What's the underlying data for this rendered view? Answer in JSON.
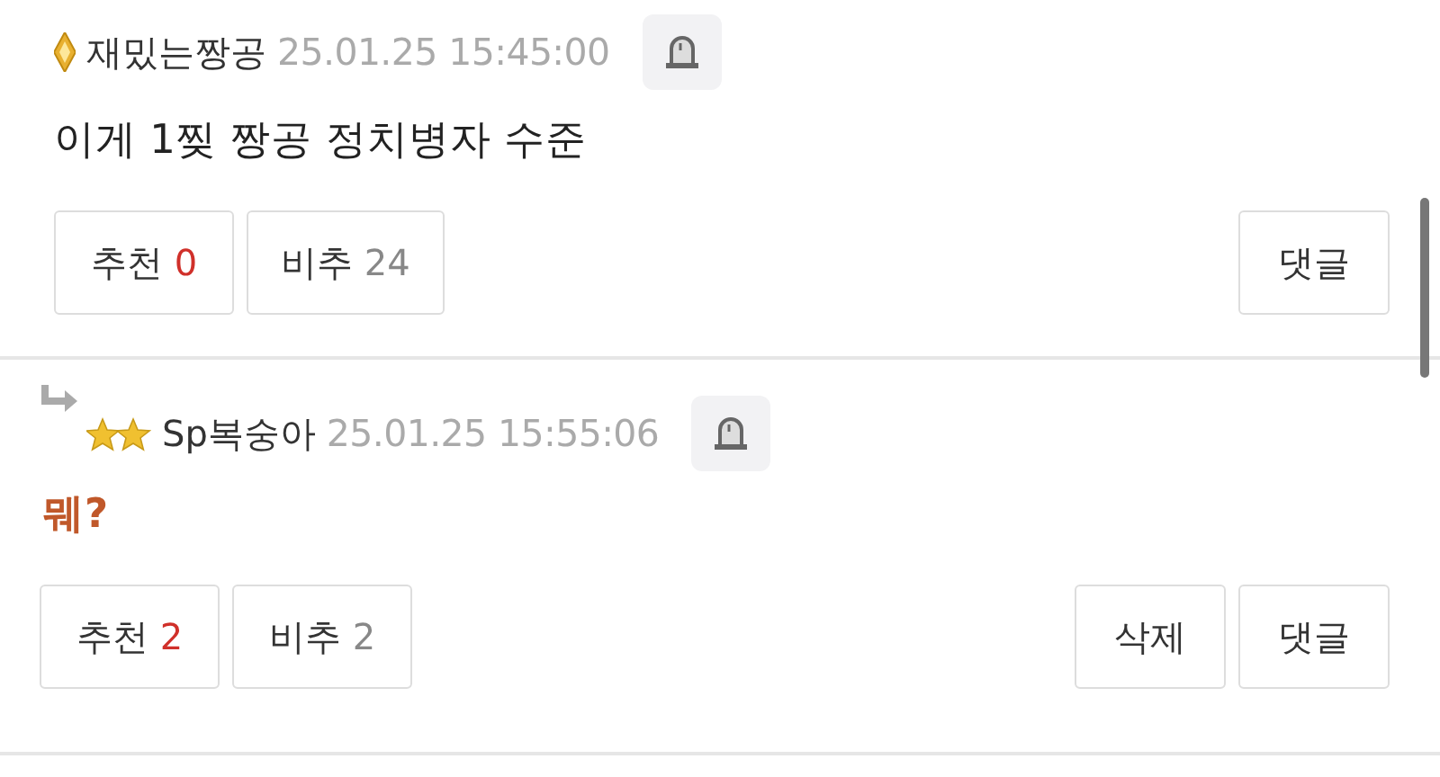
{
  "comments": [
    {
      "reply": false,
      "kind": "plain",
      "badge": {
        "kind": "diamond"
      },
      "author": "재밌는짱공",
      "time": "25.01.25 15:45:00",
      "body": "이게 1찢 짱공 정치병자 수준",
      "buttons": [
        {
          "kind": "vote",
          "label": "추천",
          "count": "0",
          "positive": true
        },
        {
          "kind": "vote",
          "label": "비추",
          "count": "24",
          "positive": false
        },
        {
          "kind": "action",
          "label": "댓글"
        }
      ]
    },
    {
      "reply": true,
      "kind": "accent",
      "badge": {
        "kind": "stars"
      },
      "author": "Sp복숭아",
      "time": "25.01.25 15:55:06",
      "body": "뭬?",
      "buttons": [
        {
          "kind": "vote",
          "label": "추천",
          "count": "2",
          "positive": true
        },
        {
          "kind": "vote",
          "label": "비추",
          "count": "2",
          "positive": false
        },
        {
          "kind": "action",
          "label": "삭제"
        },
        {
          "kind": "action",
          "label": "댓글"
        }
      ]
    }
  ]
}
